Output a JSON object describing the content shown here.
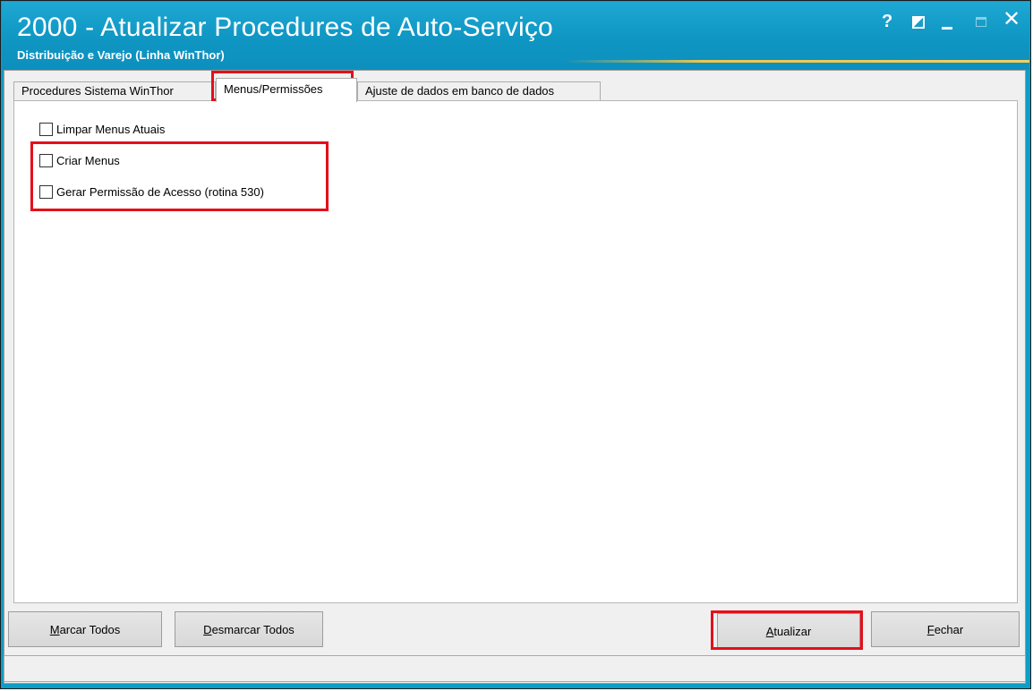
{
  "window": {
    "title": "2000 - Atualizar Procedures de Auto-Serviço",
    "subtitle": "Distribuição e Varejo (Linha WinThor)",
    "help_label": "?",
    "close_label": "✕"
  },
  "tabs": [
    {
      "label": "Procedures Sistema WinThor"
    },
    {
      "label": "Menus/Permissões",
      "selected": true
    },
    {
      "label": "Ajuste de dados em banco de dados"
    }
  ],
  "options": [
    {
      "label": "Limpar Menus Atuais",
      "checked": false
    },
    {
      "label": "Criar Menus",
      "checked": false
    },
    {
      "label": "Gerar Permissão de Acesso (rotina 530)",
      "checked": false
    }
  ],
  "buttons": {
    "marcar_todos": {
      "mnemonic": "M",
      "rest": "arcar Todos"
    },
    "desmarcar_todos": {
      "mnemonic": "D",
      "rest": "esmarcar Todos"
    },
    "atualizar": {
      "mnemonic": "A",
      "rest": "tualizar"
    },
    "fechar": {
      "mnemonic": "F",
      "rest": "echar"
    }
  },
  "colors": {
    "titlebar": "#0f96c3",
    "highlight": "#e3101a"
  }
}
